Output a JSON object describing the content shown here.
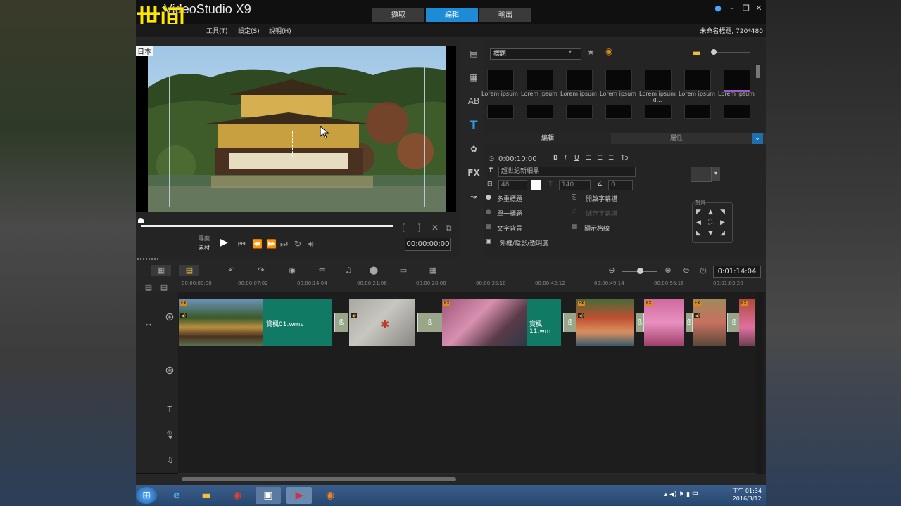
{
  "overlay": {
    "title": "世间"
  },
  "window": {
    "app_name": "VideoStudio X9",
    "project_info": "未命名標題, 720*480"
  },
  "tabs": [
    {
      "label": "擷取"
    },
    {
      "label": "編輯"
    },
    {
      "label": "輸出"
    }
  ],
  "menu": [
    {
      "label": "工具(T)"
    },
    {
      "label": "設定(S)"
    },
    {
      "label": "說明(H)"
    }
  ],
  "preview": {
    "lang_tag": "日本",
    "timecode": "00:00:00:00",
    "mode_project": "專案",
    "mode_clip": "素材"
  },
  "library": {
    "category": "標題",
    "thumbs_row1": [
      "Lorem ipsum",
      "Lorem ipsum",
      "Lorem ipsum",
      "Lorem ipsum",
      "Lorem ipsum d...",
      "Lorem ipsum",
      "Lorem ipsum"
    ],
    "tab_edit": "編輯",
    "tab_attr": "屬性",
    "duration": "0:00:10:00",
    "font": "超世紀新細黑",
    "font_size": "48",
    "line_spacing": "140",
    "angle": "0",
    "multi_title": "多重標題",
    "single_title": "單一標題",
    "text_bg": "文字背景",
    "show_grid": "顯示格線",
    "open_subtitle": "開啟字幕檔",
    "save_subtitle": "儲存字幕檔",
    "border_shadow": "外框/陰影/透明度",
    "align_label": "對齊"
  },
  "timeline": {
    "zoom_timecode": "0:01:14:04",
    "ruler": [
      "00:00:00:00",
      "00:00:07:02",
      "00:00:14:04",
      "00:00:21:06",
      "00:00:28:08",
      "00:00:35:10",
      "00:00:42:12",
      "00:00:49:14",
      "00:00:56:16",
      "00:01:03:20"
    ],
    "clips": [
      {
        "name": "賞楓01.wmv"
      },
      {
        "name": "賞楓11.wm"
      }
    ]
  },
  "taskbar": {
    "time": "下午 01:34",
    "date": "2016/3/12"
  },
  "colors": {
    "accent": "#1d8bd6",
    "title_clip": "#117a64",
    "overlay": "#ffe600"
  }
}
